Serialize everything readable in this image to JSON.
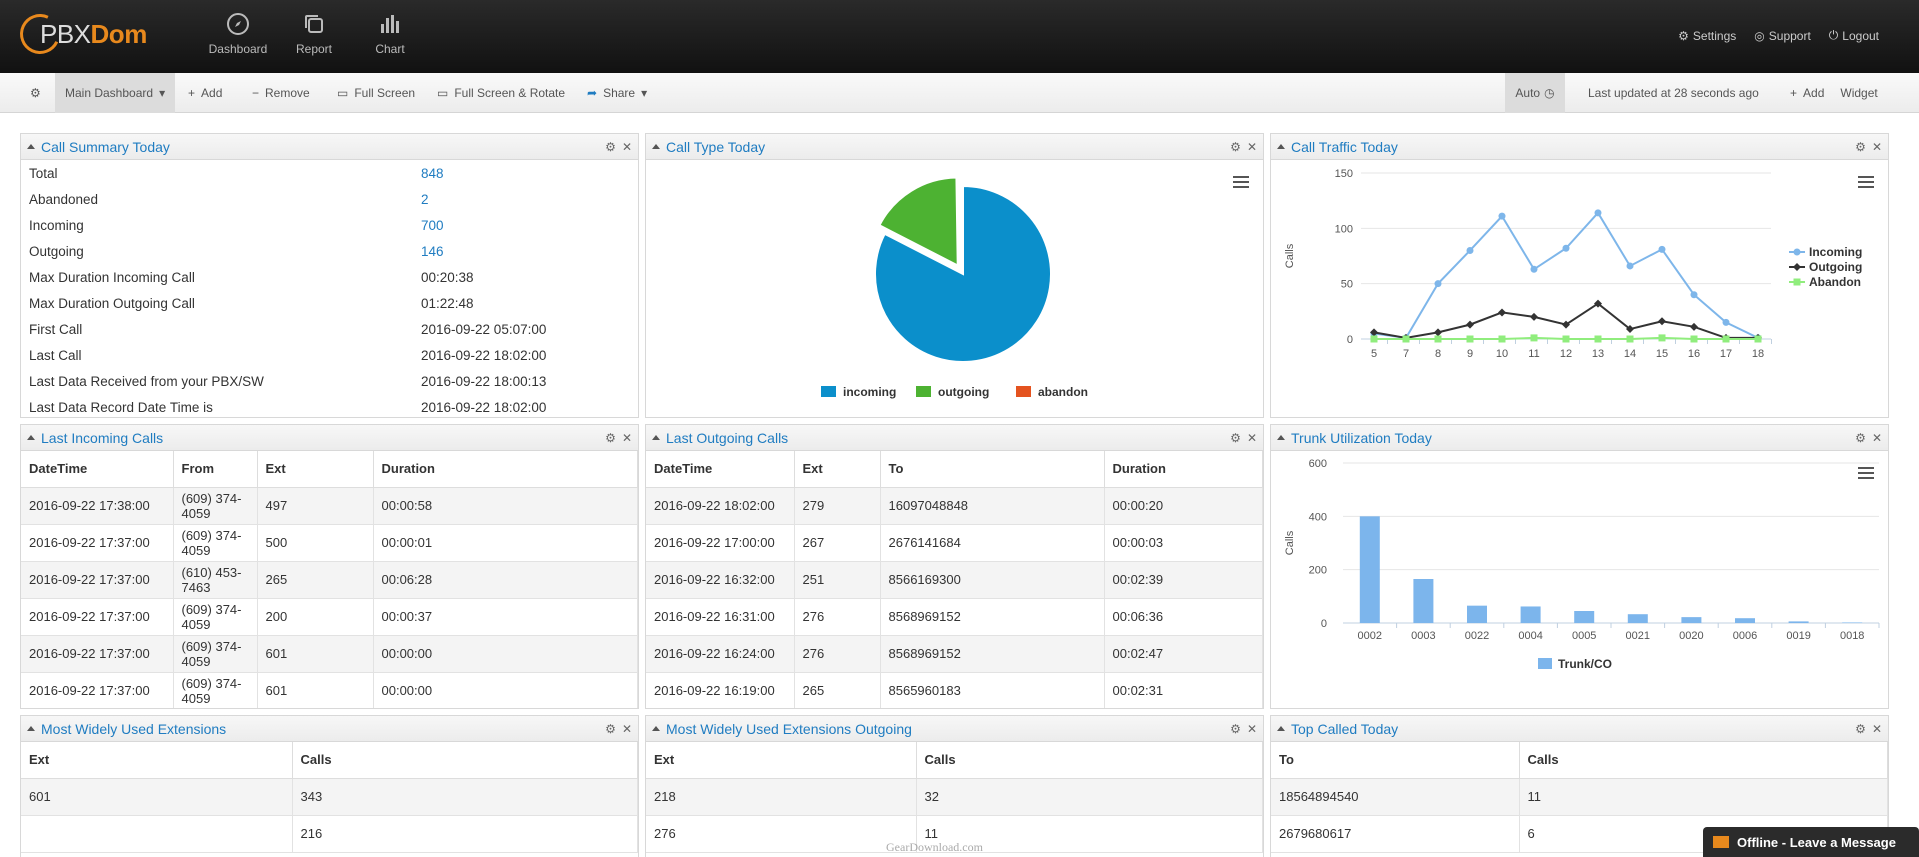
{
  "header": {
    "logo": {
      "pbx": "PBX",
      "dom": "Dom"
    },
    "nav": [
      {
        "label": "Dashboard",
        "icon": "compass-icon"
      },
      {
        "label": "Report",
        "icon": "copy-icon"
      },
      {
        "label": "Chart",
        "icon": "bar-chart-icon"
      }
    ],
    "links": {
      "settings": "Settings",
      "support": "Support",
      "logout": "Logout"
    }
  },
  "toolbar": {
    "main_dashboard": "Main Dashboard",
    "add": "Add",
    "remove": "Remove",
    "full_screen": "Full Screen",
    "full_screen_rotate": "Full Screen & Rotate",
    "share": "Share",
    "auto": "Auto",
    "last_updated": "Last updated at 28 seconds ago",
    "add_widget": "Add",
    "widget": "Widget"
  },
  "call_summary": {
    "title": "Call Summary Today",
    "rows": [
      {
        "k": "Total",
        "v": "848"
      },
      {
        "k": "Abandoned",
        "v": "2"
      },
      {
        "k": "Incoming",
        "v": "700"
      },
      {
        "k": "Outgoing",
        "v": "146"
      },
      {
        "k": "Max Duration Incoming Call",
        "v": "00:20:38"
      },
      {
        "k": "Max Duration Outgoing Call",
        "v": "01:22:48"
      },
      {
        "k": "First Call",
        "v": "2016-09-22 05:07:00"
      },
      {
        "k": "Last Call",
        "v": "2016-09-22 18:02:00"
      },
      {
        "k": "Last Data Received from your PBX/SW",
        "v": "2016-09-22 18:00:13"
      },
      {
        "k": "Last Data Record Date Time is",
        "v": "2016-09-22 18:02:00"
      }
    ]
  },
  "call_type": {
    "title": "Call Type Today"
  },
  "call_traffic": {
    "title": "Call Traffic Today"
  },
  "last_incoming": {
    "title": "Last Incoming Calls",
    "headers": [
      "DateTime",
      "From",
      "Ext",
      "Duration"
    ],
    "rows": [
      [
        "2016-09-22 17:38:00",
        "(609) 374-4059",
        "497",
        "00:00:58"
      ],
      [
        "2016-09-22 17:37:00",
        "(609) 374-4059",
        "500",
        "00:00:01"
      ],
      [
        "2016-09-22 17:37:00",
        "(610) 453-7463",
        "265",
        "00:06:28"
      ],
      [
        "2016-09-22 17:37:00",
        "(609) 374-4059",
        "200",
        "00:00:37"
      ],
      [
        "2016-09-22 17:37:00",
        "(609) 374-4059",
        "601",
        "00:00:00"
      ],
      [
        "2016-09-22 17:37:00",
        "(609) 374-4059",
        "601",
        "00:00:00"
      ]
    ]
  },
  "last_outgoing": {
    "title": "Last Outgoing Calls",
    "headers": [
      "DateTime",
      "Ext",
      "To",
      "Duration"
    ],
    "rows": [
      [
        "2016-09-22 18:02:00",
        "279",
        "16097048848",
        "00:00:20"
      ],
      [
        "2016-09-22 17:00:00",
        "267",
        "2676141684",
        "00:00:03"
      ],
      [
        "2016-09-22 16:32:00",
        "251",
        "8566169300",
        "00:02:39"
      ],
      [
        "2016-09-22 16:31:00",
        "276",
        "8568969152",
        "00:06:36"
      ],
      [
        "2016-09-22 16:24:00",
        "276",
        "8568969152",
        "00:02:47"
      ],
      [
        "2016-09-22 16:19:00",
        "265",
        "8565960183",
        "00:02:31"
      ]
    ]
  },
  "trunk": {
    "title": "Trunk Utilization Today"
  },
  "most_used_ext": {
    "title": "Most Widely Used Extensions",
    "headers": [
      "Ext",
      "Calls"
    ],
    "rows": [
      [
        "601",
        "343"
      ],
      [
        "",
        "216"
      ]
    ]
  },
  "most_used_out": {
    "title": "Most Widely Used Extensions Outgoing",
    "headers": [
      "Ext",
      "Calls"
    ],
    "rows": [
      [
        "218",
        "32"
      ],
      [
        "276",
        "11"
      ]
    ]
  },
  "top_called": {
    "title": "Top Called Today",
    "headers": [
      "To",
      "Calls"
    ],
    "rows": [
      [
        "18564894540",
        "11"
      ],
      [
        "2679680617",
        "6"
      ]
    ]
  },
  "watermark": "GearDownload.com",
  "offline": "Offline - Leave a Message",
  "chart_data": [
    {
      "type": "pie",
      "title": "",
      "series": [
        {
          "name": "incoming",
          "values": [
            700
          ]
        },
        {
          "name": "outgoing",
          "values": [
            146
          ]
        },
        {
          "name": "abandon",
          "values": [
            2
          ]
        }
      ],
      "categories": [
        "incoming",
        "outgoing",
        "abandon"
      ],
      "values": [
        700,
        146,
        2
      ],
      "colors": [
        "#0b8fcb",
        "#4db232",
        "#e4531f"
      ],
      "legend": "bottom"
    },
    {
      "type": "line",
      "title": "",
      "ylabel": "Calls",
      "x": [
        5,
        7,
        8,
        9,
        10,
        11,
        12,
        13,
        14,
        15,
        16,
        17,
        18
      ],
      "ylim": [
        0,
        150
      ],
      "yticks": [
        0,
        50,
        100,
        150
      ],
      "series": [
        {
          "name": "Incoming",
          "color": "#7eb6ea",
          "values": [
            5,
            1,
            50,
            80,
            111,
            63,
            82,
            114,
            66,
            81,
            40,
            15,
            1
          ]
        },
        {
          "name": "Outgoing",
          "color": "#333333",
          "values": [
            6,
            1,
            6,
            13,
            24,
            20,
            13,
            32,
            9,
            16,
            11,
            1,
            1
          ]
        },
        {
          "name": "Abandon",
          "color": "#90ed7d",
          "values": [
            0,
            0,
            0,
            0,
            0,
            1,
            0,
            0,
            0,
            1,
            0,
            0,
            0
          ]
        }
      ],
      "grid": true,
      "legend": "right"
    },
    {
      "type": "bar",
      "title": "",
      "ylabel": "Calls",
      "categories": [
        "0002",
        "0003",
        "0022",
        "0004",
        "0005",
        "0021",
        "0020",
        "0006",
        "0019",
        "0018"
      ],
      "values": [
        400,
        165,
        65,
        62,
        45,
        33,
        22,
        18,
        6,
        2
      ],
      "ylim": [
        0,
        600
      ],
      "yticks": [
        0,
        200,
        400,
        600
      ],
      "series": [
        {
          "name": "Trunk/CO",
          "values": [
            400,
            165,
            65,
            62,
            45,
            33,
            22,
            18,
            6,
            2
          ]
        }
      ],
      "color": "#7cb5ec",
      "grid": true,
      "legend": "bottom"
    }
  ]
}
